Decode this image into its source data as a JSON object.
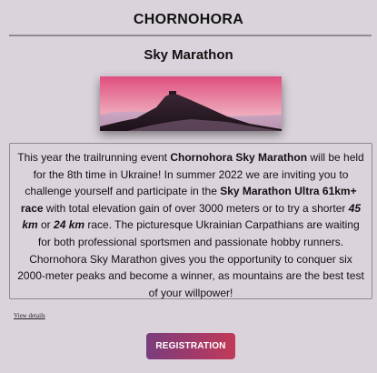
{
  "header": {
    "title": "CHORNOHORA"
  },
  "event": {
    "title": "Sky Marathon",
    "hero_image": "mountain-sunset-image",
    "description": {
      "p1": "This year the trailrunning event ",
      "b1": "Chornohora Sky Marathon",
      "p2": " will be held for the 8th time in Ukraine! In summer 2022 we are inviting you to challenge yourself and participate in the ",
      "b2": "Sky Marathon Ultra 61km+ race",
      "p3": " with total elevation gain of over 3000 meters or to try a shorter ",
      "bi1": "45 km",
      "p4": " or ",
      "bi2": "24 km",
      "p5": " race. The picturesque Ukrainian Carpathians are waiting for both professional sportsmen and passionate hobby runners. Chornohora Sky Marathon gives you the opportunity to conquer six 2000-meter peaks and become a winner, as mountains are the best test of your willpower!"
    },
    "view_details_label": "View details",
    "registration_label": "REGISTRATION"
  },
  "colors": {
    "background": "#dbd3dc",
    "divider": "#8e8a90",
    "button_gradient_start": "#7a3d7d",
    "button_gradient_end": "#c23a58"
  }
}
